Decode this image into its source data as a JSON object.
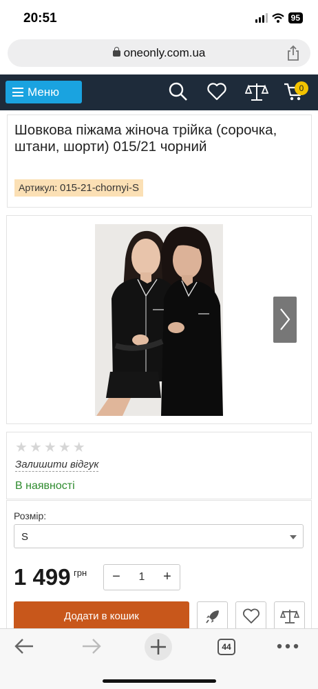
{
  "status_bar": {
    "time": "20:51",
    "battery": "95"
  },
  "browser": {
    "url": "oneonly.com.ua",
    "tabs_count": "44"
  },
  "header": {
    "menu_label": "Меню",
    "cart_count": "0"
  },
  "product": {
    "title": "Шовкова піжама жіноча трійка (сорочка, штани, шорти) 015/21 чорний",
    "sku_label": "Артикул:",
    "sku_value": "015-21-chornyi-S",
    "review_link": "Залишити відгук",
    "availability": "В наявності",
    "rating": 0,
    "rating_max": 5
  },
  "options": {
    "size_label": "Розмір:",
    "size_value": "S",
    "price": "1 499",
    "currency": "грн",
    "quantity": "1",
    "qty_minus": "−",
    "qty_plus": "+",
    "add_to_cart": "Додати в кошик"
  },
  "colors": {
    "header_bg": "#1e2b3a",
    "menu_button": "#1aa3e0",
    "cart_badge": "#f2c200",
    "add_to_cart": "#c8571b",
    "in_stock": "#2e8b2e",
    "sku_bg": "#fbe0b5"
  },
  "icons": {
    "header": [
      "search-icon",
      "heart-icon",
      "scales-icon",
      "cart-icon"
    ],
    "actions": [
      "rocket-icon",
      "heart-icon",
      "scales-icon"
    ],
    "toolbar": [
      "back-arrow-icon",
      "forward-arrow-icon",
      "new-tab-icon",
      "tabs-icon",
      "more-icon"
    ]
  }
}
